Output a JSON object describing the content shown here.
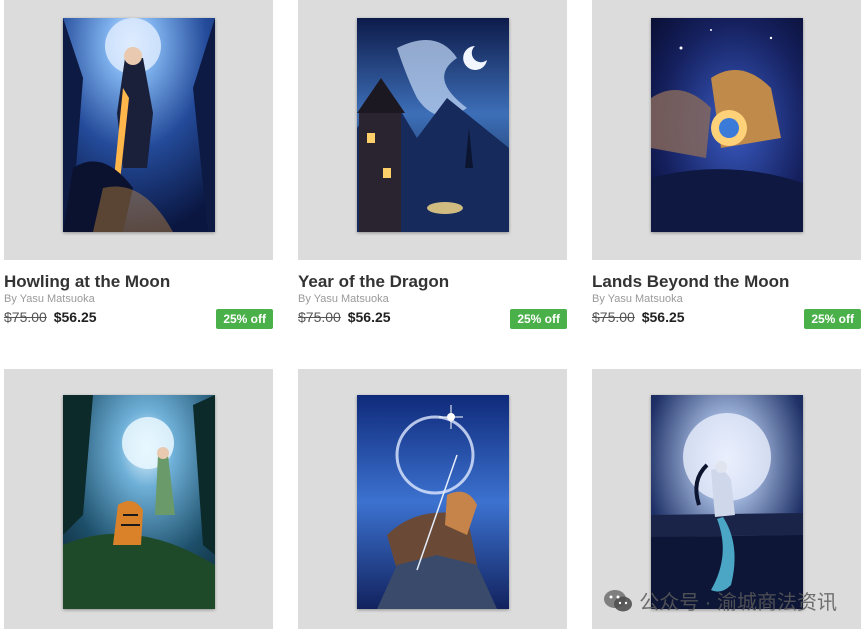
{
  "products": [
    {
      "title": "Howling at the Moon",
      "artist": "By Yasu Matsuoka",
      "old_price": "$75.00",
      "price": "$56.25",
      "badge": "25% off"
    },
    {
      "title": "Year of the Dragon",
      "artist": "By Yasu Matsuoka",
      "old_price": "$75.00",
      "price": "$56.25",
      "badge": "25% off"
    },
    {
      "title": "Lands Beyond the Moon",
      "artist": "By Yasu Matsuoka",
      "old_price": "$75.00",
      "price": "$56.25",
      "badge": "25% off"
    },
    {
      "title": "",
      "artist": "",
      "old_price": "",
      "price": "",
      "badge": ""
    },
    {
      "title": "",
      "artist": "",
      "old_price": "",
      "price": "",
      "badge": ""
    },
    {
      "title": "",
      "artist": "",
      "old_price": "",
      "price": "",
      "badge": ""
    }
  ],
  "watermark": {
    "text": "公众号 · 渝城商法资讯",
    "icon": "wechat-icon"
  },
  "colors": {
    "badge": "#4ab04a",
    "thumb_bg": "#dcdcdc",
    "title": "#333333"
  }
}
